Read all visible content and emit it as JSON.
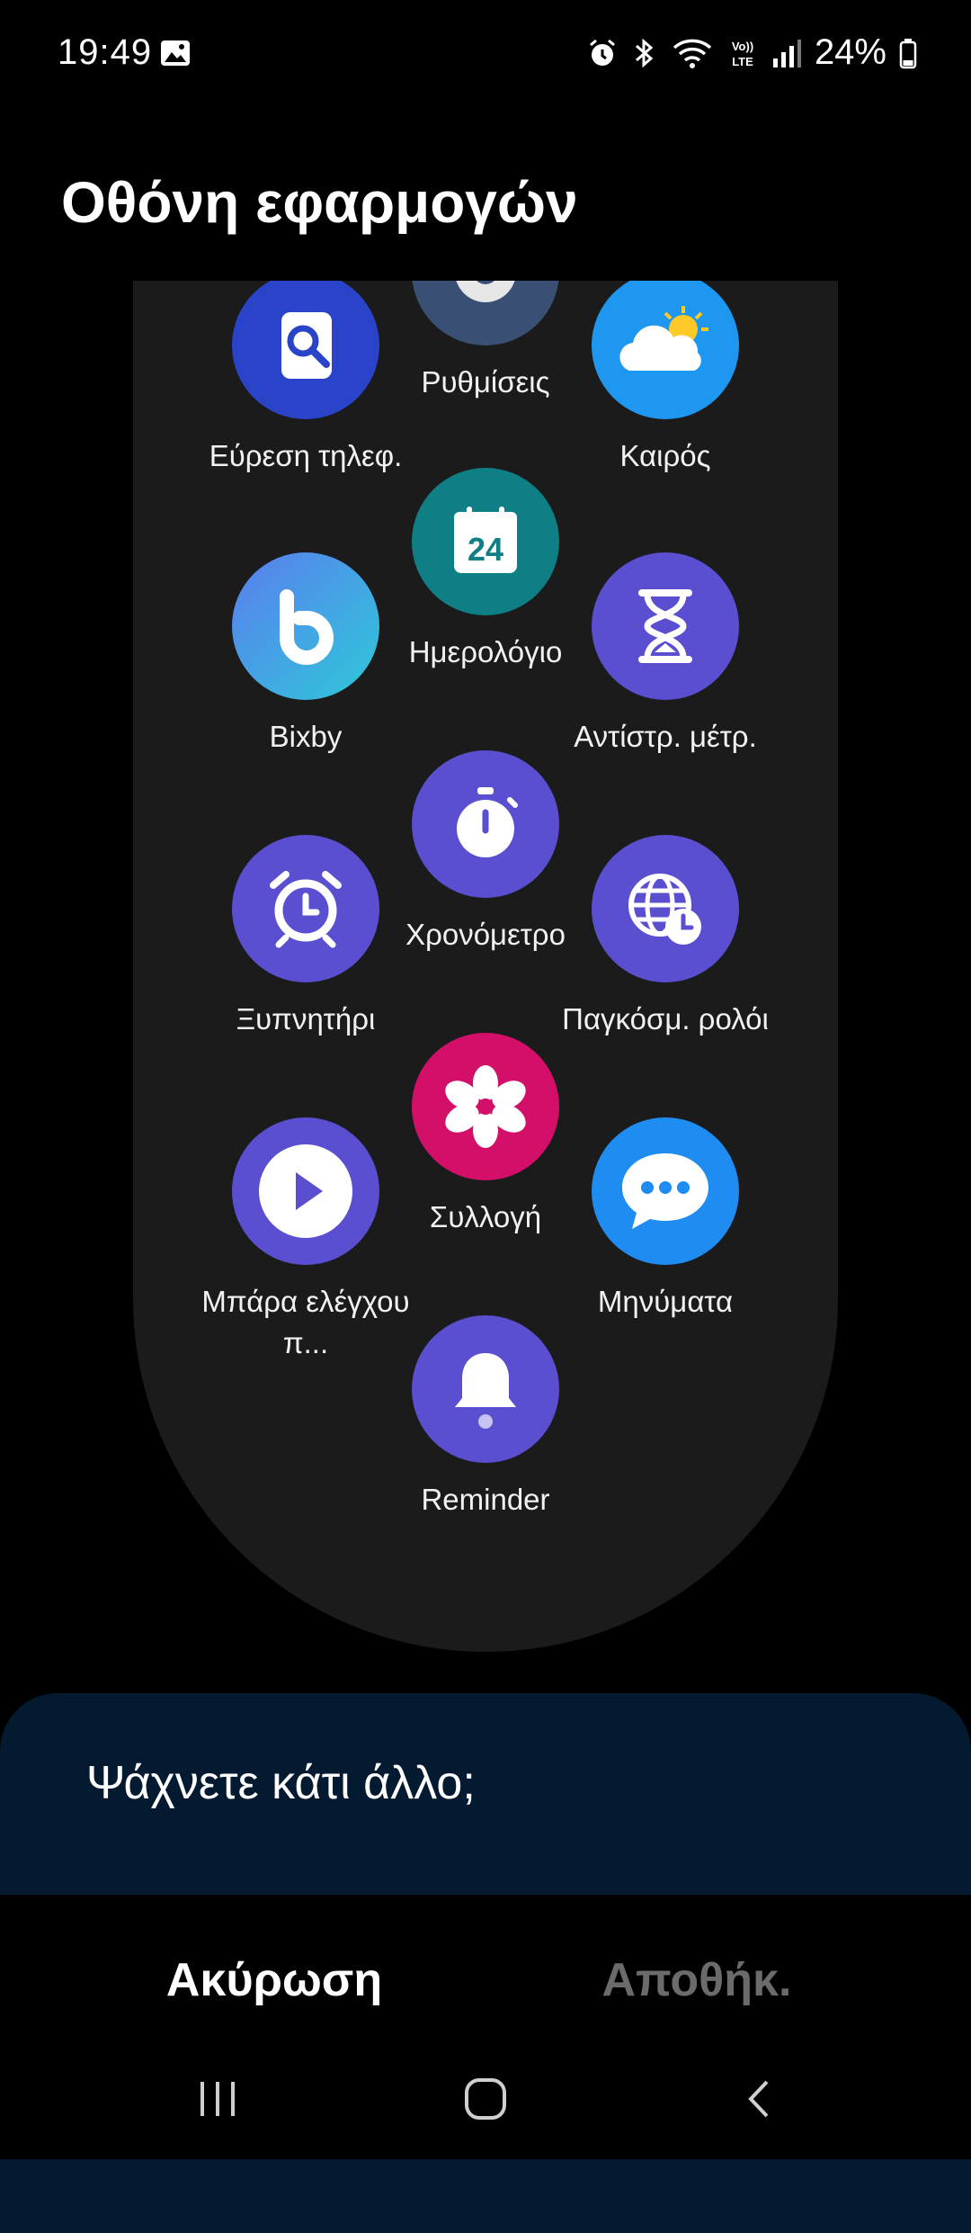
{
  "status_bar": {
    "time": "19:49",
    "battery": "24%",
    "icons": [
      "gallery-icon",
      "alarm-icon",
      "bluetooth-icon",
      "wifi-icon",
      "volte-lte-icon",
      "signal-icon",
      "battery-icon"
    ]
  },
  "page": {
    "title": "Οθόνη εφαρμογών"
  },
  "apps": [
    {
      "label": "Ρυθμίσεις",
      "icon": "settings-gear-icon",
      "color": "#3a4f74"
    },
    {
      "label": "Εύρεση τηλεφ.",
      "icon": "find-phone-icon",
      "color": "#2a44c9"
    },
    {
      "label": "Καιρός",
      "icon": "weather-icon",
      "color": "#1e97f0"
    },
    {
      "label": "Ημερολόγιο",
      "icon": "calendar-icon",
      "color": "#0f7f86",
      "badge": "24"
    },
    {
      "label": "Bixby",
      "icon": "bixby-icon",
      "color": "#3fa6ee"
    },
    {
      "label": "Αντίστρ. μέτρ.",
      "icon": "hourglass-icon",
      "color": "#5a4fd0"
    },
    {
      "label": "Χρονόμετρο",
      "icon": "stopwatch-icon",
      "color": "#5a4fd0"
    },
    {
      "label": "Ξυπνητήρι",
      "icon": "alarm-clock-icon",
      "color": "#5a4fd0"
    },
    {
      "label": "Παγκόσμ. ρολόι",
      "icon": "world-clock-icon",
      "color": "#5a4fd0"
    },
    {
      "label": "Συλλογή",
      "icon": "gallery-flower-icon",
      "color": "#d40f6a"
    },
    {
      "label": "Μπάρα ελέγχου π...",
      "icon": "media-play-icon",
      "color": "#5a4fd0"
    },
    {
      "label": "Μηνύματα",
      "icon": "messages-icon",
      "color": "#1e8cf0"
    },
    {
      "label": "Reminder",
      "icon": "bell-icon",
      "color": "#5a4fd0"
    }
  ],
  "sheet": {
    "title": "Ψάχνετε κάτι άλλο;"
  },
  "actions": {
    "cancel": "Ακύρωση",
    "save": "Αποθήκ."
  },
  "nav": {
    "recents": "recents-icon",
    "home": "home-icon",
    "back": "back-icon"
  }
}
